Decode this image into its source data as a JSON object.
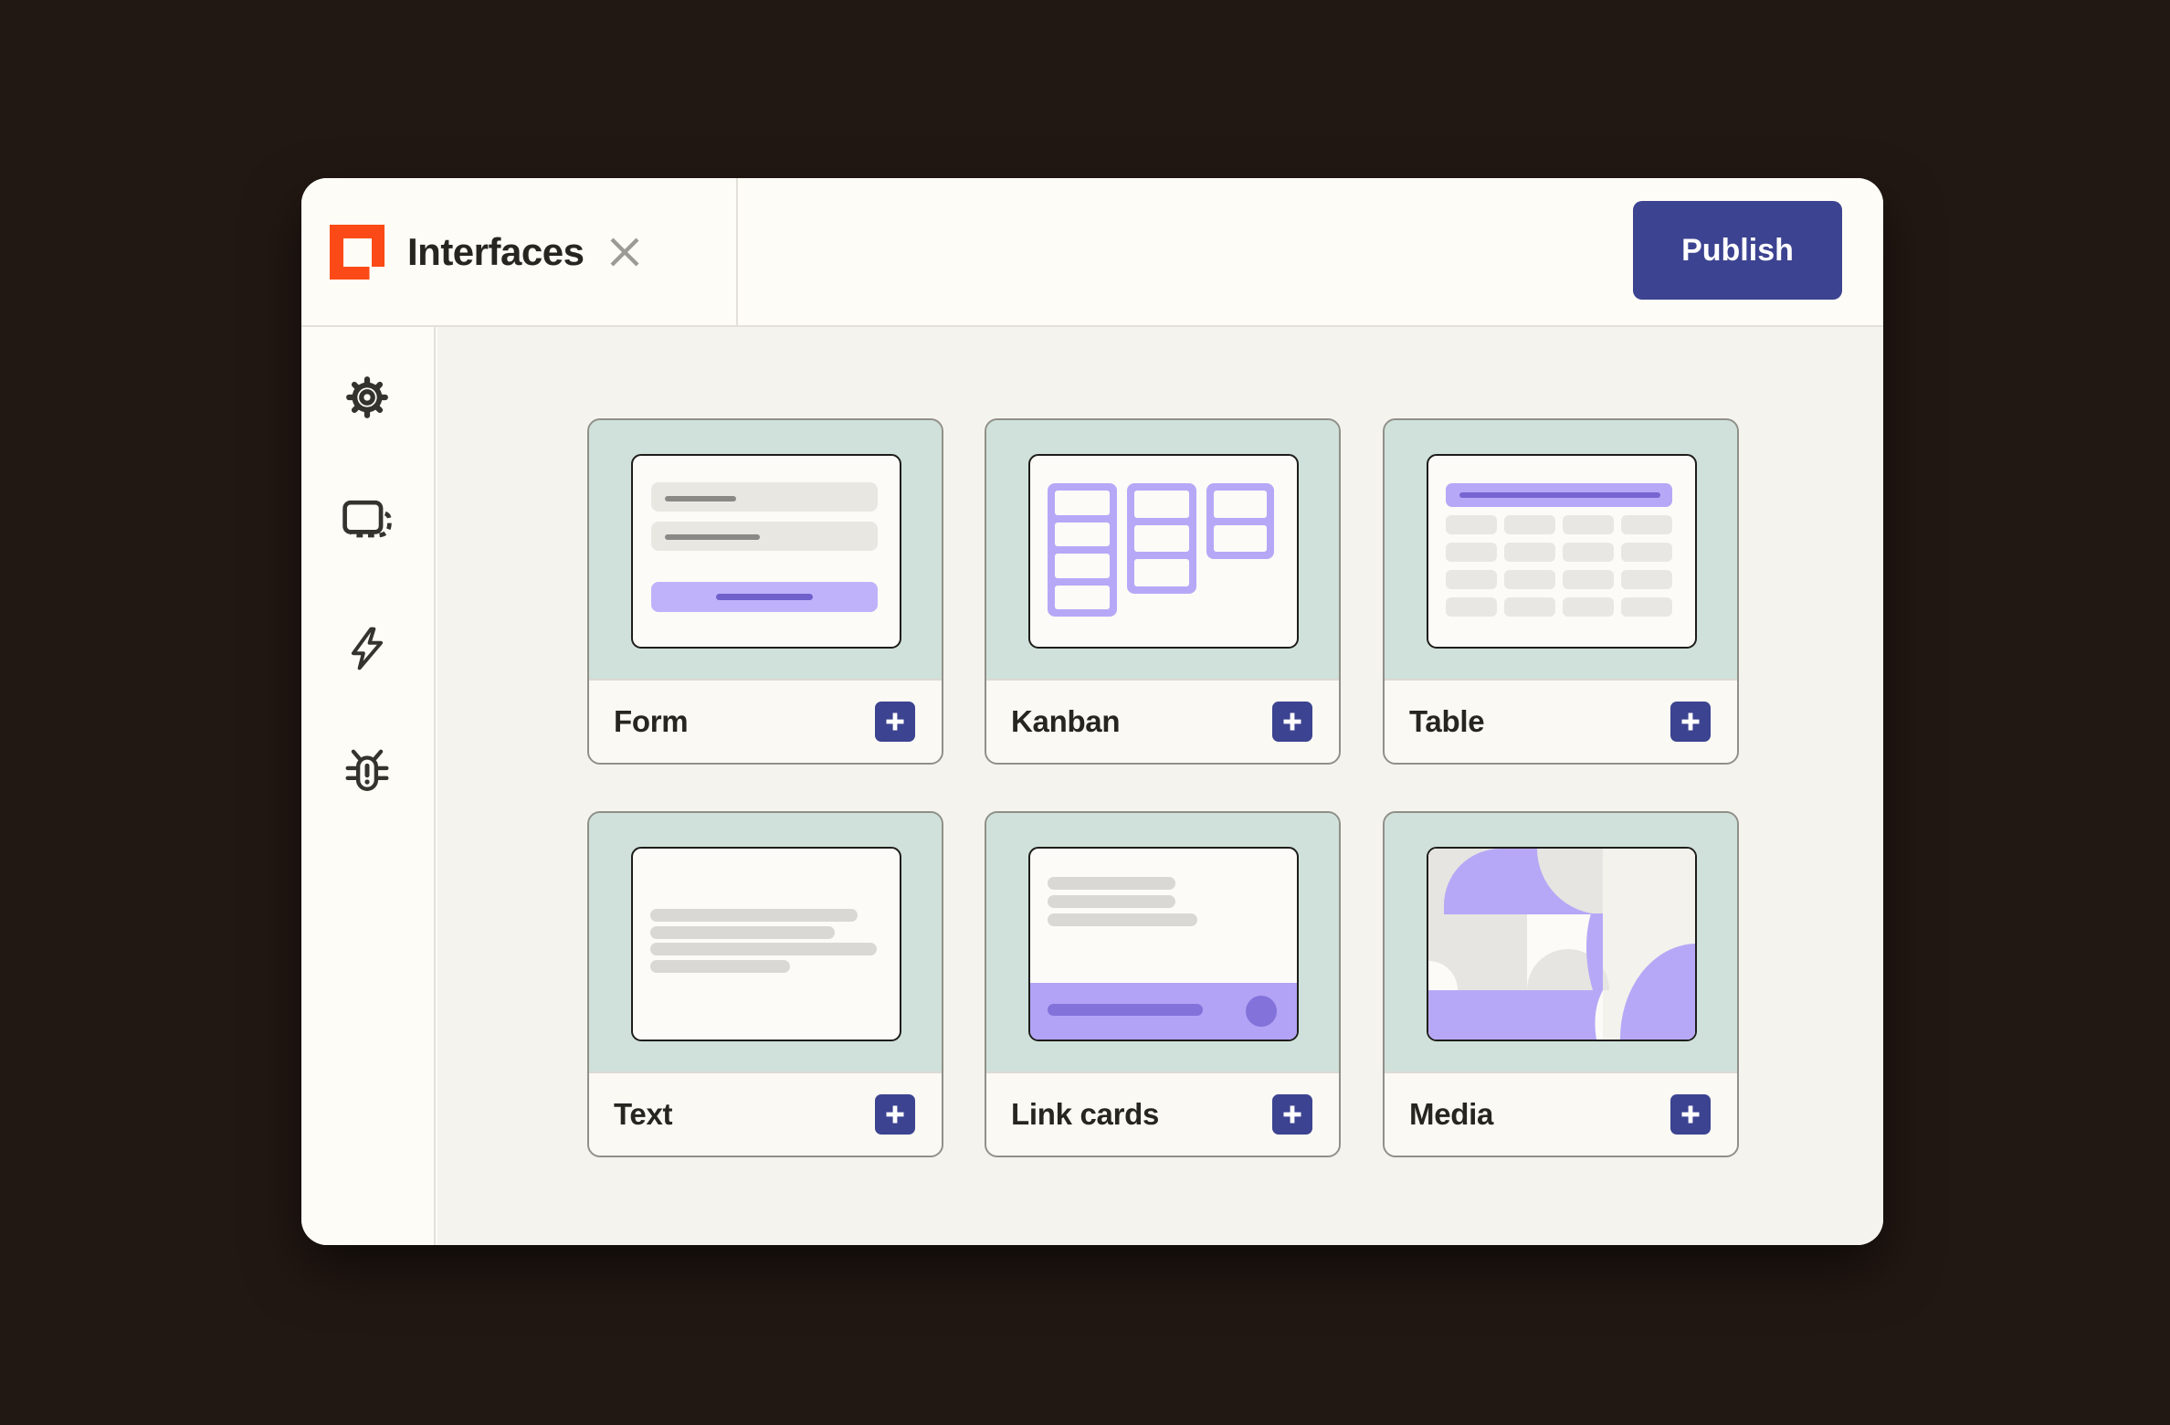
{
  "app": {
    "title": "Interfaces",
    "publish_label": "Publish",
    "logo_icon": "interfaces-logo",
    "close_icon": "close-icon"
  },
  "sidebar": {
    "items": [
      {
        "icon": "settings-gear-icon",
        "name": "settings"
      },
      {
        "icon": "screens-icon",
        "name": "screens"
      },
      {
        "icon": "zap-lightning-icon",
        "name": "zaps"
      },
      {
        "icon": "debug-bug-icon",
        "name": "debug"
      }
    ]
  },
  "cards": [
    {
      "label": "Form",
      "preview": "form-component-thumbnail"
    },
    {
      "label": "Kanban",
      "preview": "kanban-component-thumbnail"
    },
    {
      "label": "Table",
      "preview": "table-component-thumbnail"
    },
    {
      "label": "Text",
      "preview": "text-component-thumbnail"
    },
    {
      "label": "Link cards",
      "preview": "link-cards-component-thumbnail"
    },
    {
      "label": "Media",
      "preview": "media-component-thumbnail"
    }
  ],
  "colors": {
    "backdrop": "#221813",
    "window_bg": "#fdfcf7",
    "content_bg": "#f4f3ee",
    "card_mint": "#cfe1da",
    "accent_indigo": "#3c4390",
    "brand_orange": "#fb4a17",
    "purple_light": "#b7a8f7",
    "purple_mid": "#7766d1",
    "icon_dark": "#34332e"
  }
}
